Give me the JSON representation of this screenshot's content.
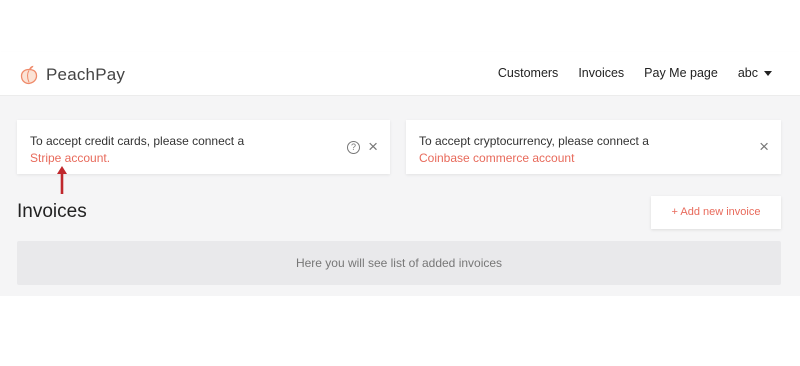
{
  "header": {
    "logo_text": "PeachPay",
    "nav": {
      "customers": "Customers",
      "invoices": "Invoices",
      "pay_me_page": "Pay Me page",
      "user": "abc"
    }
  },
  "notices": {
    "stripe": {
      "text": "To accept credit cards, please connect a",
      "link": "Stripe account."
    },
    "coinbase": {
      "text": "To accept cryptocurrency, please connect a",
      "link": "Coinbase commerce account"
    }
  },
  "main": {
    "title": "Invoices",
    "add_button": "+ Add new invoice",
    "empty_message": "Here you will see list of added invoices"
  },
  "colors": {
    "accent": "#e86a5b",
    "annotation_arrow": "#c0282d"
  }
}
